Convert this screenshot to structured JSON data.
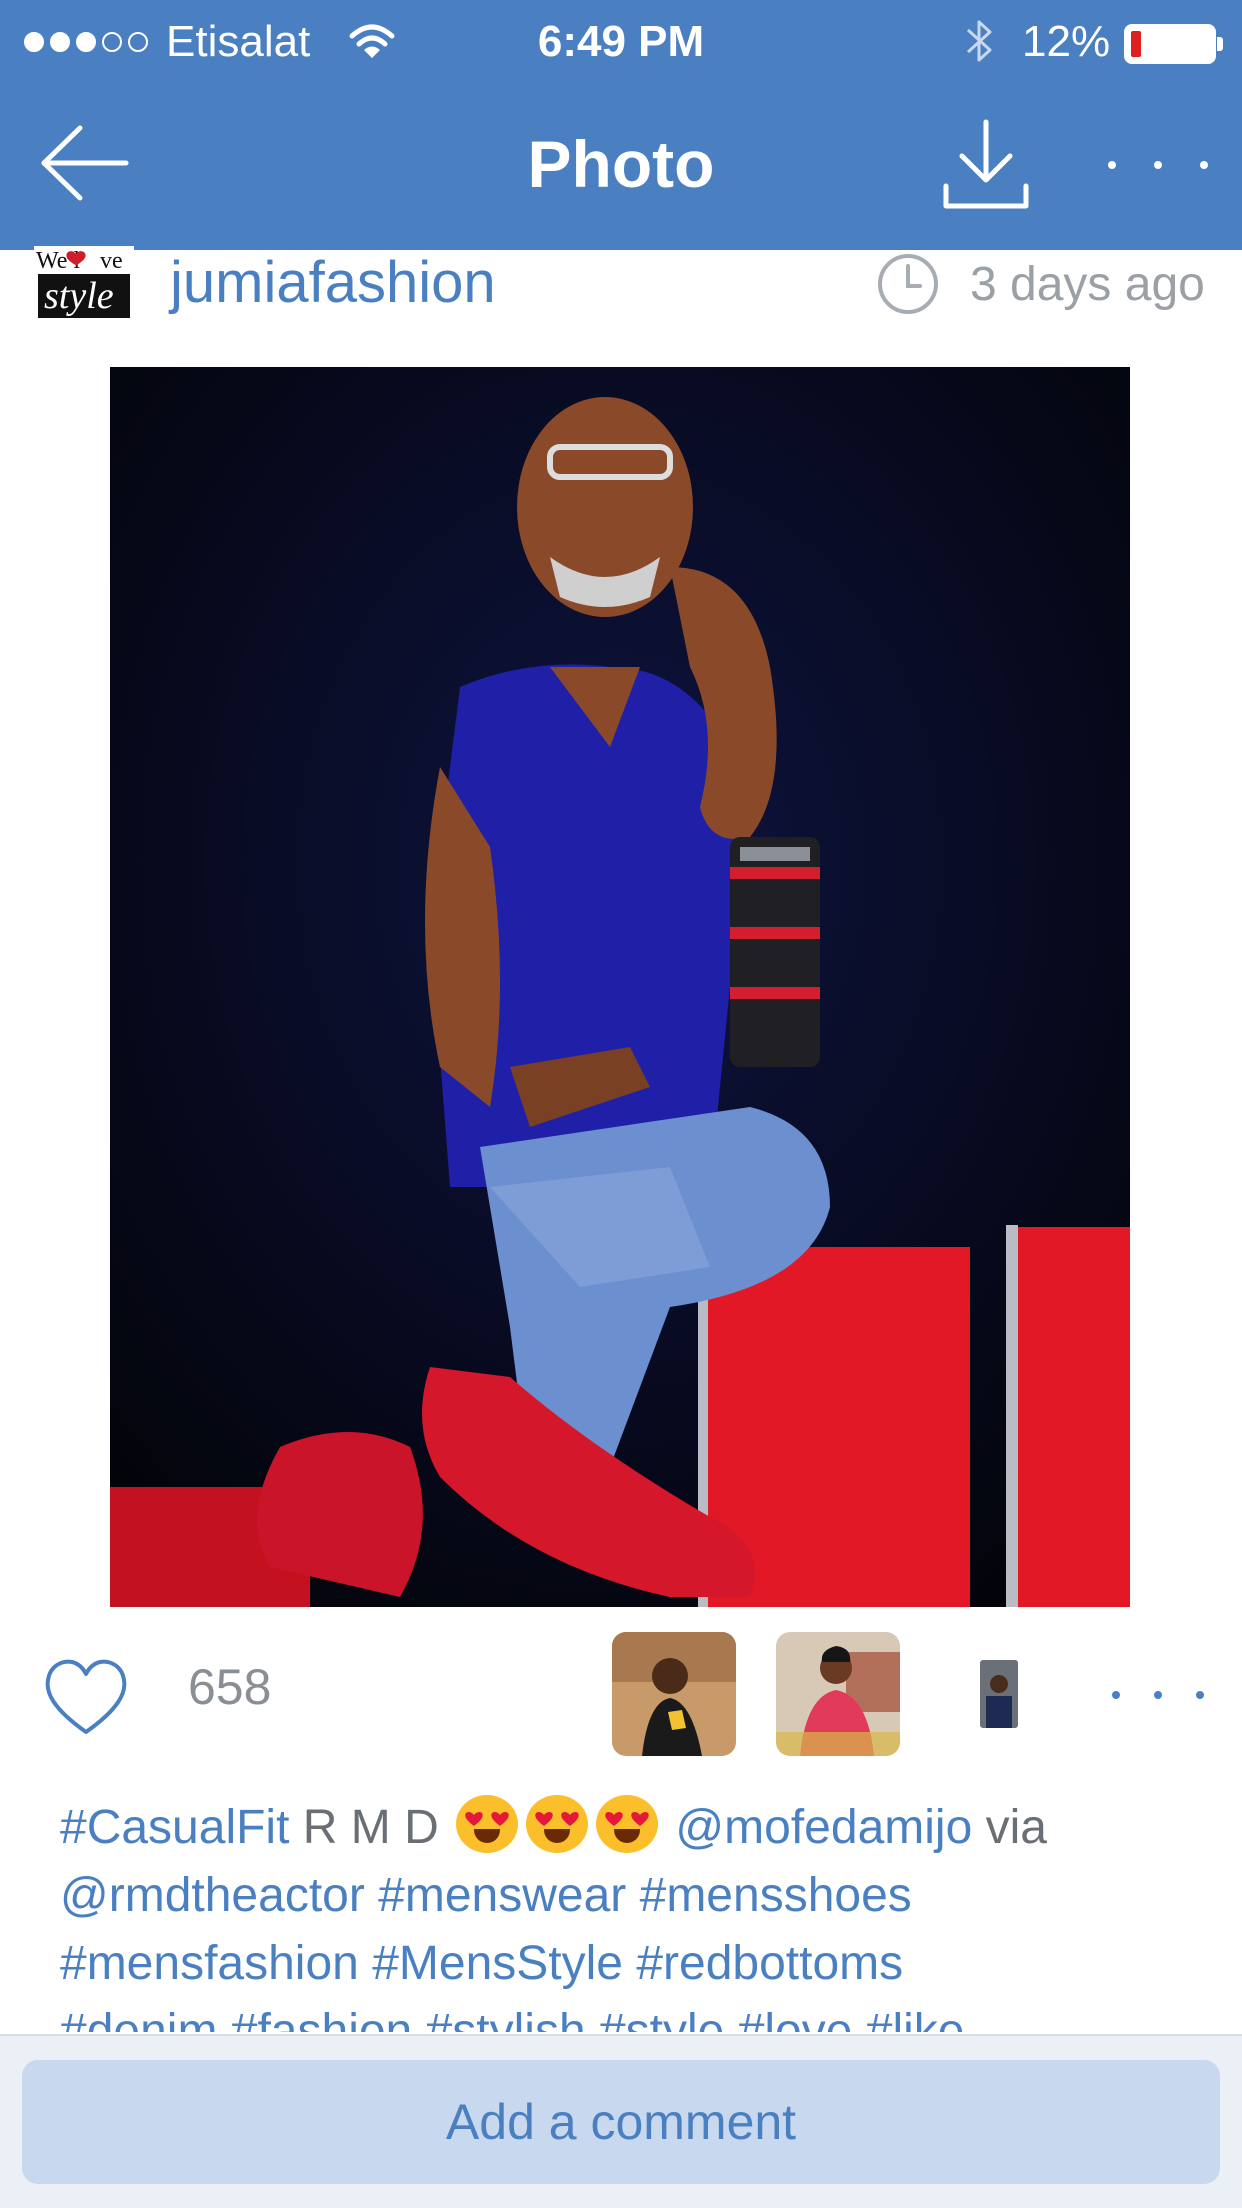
{
  "status_bar": {
    "carrier": "Etisalat",
    "time": "6:49 PM",
    "battery_percent": "12%",
    "battery_level": 0.12,
    "signal_bars_filled": 3,
    "signal_bars_total": 5
  },
  "nav": {
    "title": "Photo",
    "back_icon": "back-arrow-icon",
    "download_icon": "download-icon",
    "more_icon": "more-dots-icon"
  },
  "post": {
    "username": "jumiafashion",
    "logo_text": "We love style",
    "time_ago": "3 days ago",
    "photo_description_icon": "photo"
  },
  "likes": {
    "count": "658",
    "heart_icon": "heart-outline-icon"
  },
  "caption": {
    "parts": [
      {
        "t": "#CasualFit",
        "c": "tag"
      },
      {
        "t": " R M D ",
        "c": "text"
      },
      {
        "t": " @mofedamijo",
        "c": "tag"
      },
      {
        "t": " via ",
        "c": "text"
      },
      {
        "t": "@rmdtheactor",
        "c": "tag"
      },
      {
        "t": " #menswear",
        "c": "tag"
      },
      {
        "t": " #mensshoes",
        "c": "tag"
      },
      {
        "t": "#mensfashion",
        "c": "tag"
      },
      {
        "t": " #MensStyle",
        "c": "tag"
      },
      {
        "t": " #redbottoms",
        "c": "tag"
      },
      {
        "t": "#denim #fashion #stylish #style #love #like",
        "c": "tag"
      }
    ]
  },
  "comment": {
    "placeholder": "Add a comment"
  },
  "colors": {
    "accent": "#4a80c2",
    "header_bg": "#4a80c2",
    "muted": "#8a8f95",
    "comment_bg": "#c8d8ee"
  }
}
